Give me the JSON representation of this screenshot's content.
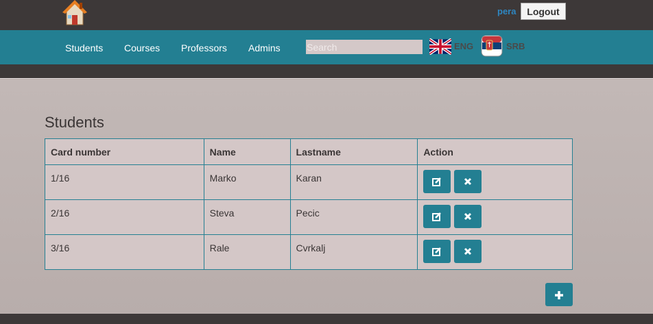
{
  "header": {
    "home_icon": "home-icon",
    "user_name": "pera",
    "logout_label": "Logout"
  },
  "nav": {
    "items": [
      {
        "label": "Students"
      },
      {
        "label": "Courses"
      },
      {
        "label": "Professors"
      },
      {
        "label": "Admins"
      }
    ],
    "search_placeholder": "Search",
    "lang_eng": "ENG",
    "lang_srb": "SRB"
  },
  "main": {
    "title": "Students",
    "columns": [
      "Card number",
      "Name",
      "Lastname",
      "Action"
    ],
    "rows": [
      {
        "card": "1/16",
        "name": "Marko",
        "lastname": "Karan"
      },
      {
        "card": "2/16",
        "name": "Steva",
        "lastname": "Pecic"
      },
      {
        "card": "3/16",
        "name": "Rale",
        "lastname": "Cvrkalj"
      }
    ],
    "edit_icon": "edit-icon",
    "delete_icon": "delete-icon",
    "add_icon": "plus-icon"
  },
  "colors": {
    "accent": "#237f92",
    "dark_bar": "#3d3838",
    "table_bg": "#d4c7c7",
    "page_bg": "#b9adab"
  }
}
